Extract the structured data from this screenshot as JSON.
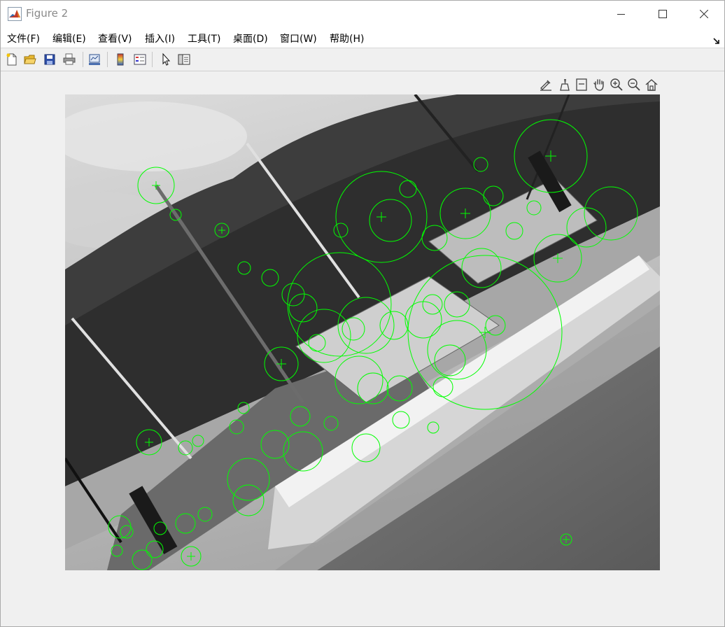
{
  "window": {
    "title": "Figure 2",
    "icon": "matlab-logo-icon",
    "controls": [
      "minimize-icon",
      "maximize-icon",
      "close-icon"
    ]
  },
  "menu": {
    "items": [
      {
        "label": "文件(F)"
      },
      {
        "label": "编辑(E)"
      },
      {
        "label": "查看(V)"
      },
      {
        "label": "插入(I)"
      },
      {
        "label": "工具(T)"
      },
      {
        "label": "桌面(D)"
      },
      {
        "label": "窗口(W)"
      },
      {
        "label": "帮助(H)"
      }
    ]
  },
  "toolbar": {
    "buttons": [
      "new-figure-icon",
      "open-file-icon",
      "save-icon",
      "print-icon",
      "link-plot-icon",
      "colorbar-icon",
      "legend-icon",
      "pointer-icon",
      "property-inspector-icon"
    ]
  },
  "axes_toolbar": {
    "buttons": [
      "brush-export-icon",
      "data-brush-icon",
      "data-tips-icon",
      "pan-hand-icon",
      "zoom-in-icon",
      "zoom-out-icon",
      "home-restore-icon"
    ]
  },
  "figure": {
    "content": "grayscale photo of fishing boats on a lakeside with feature point markers",
    "marker_color": "#00ff00"
  }
}
